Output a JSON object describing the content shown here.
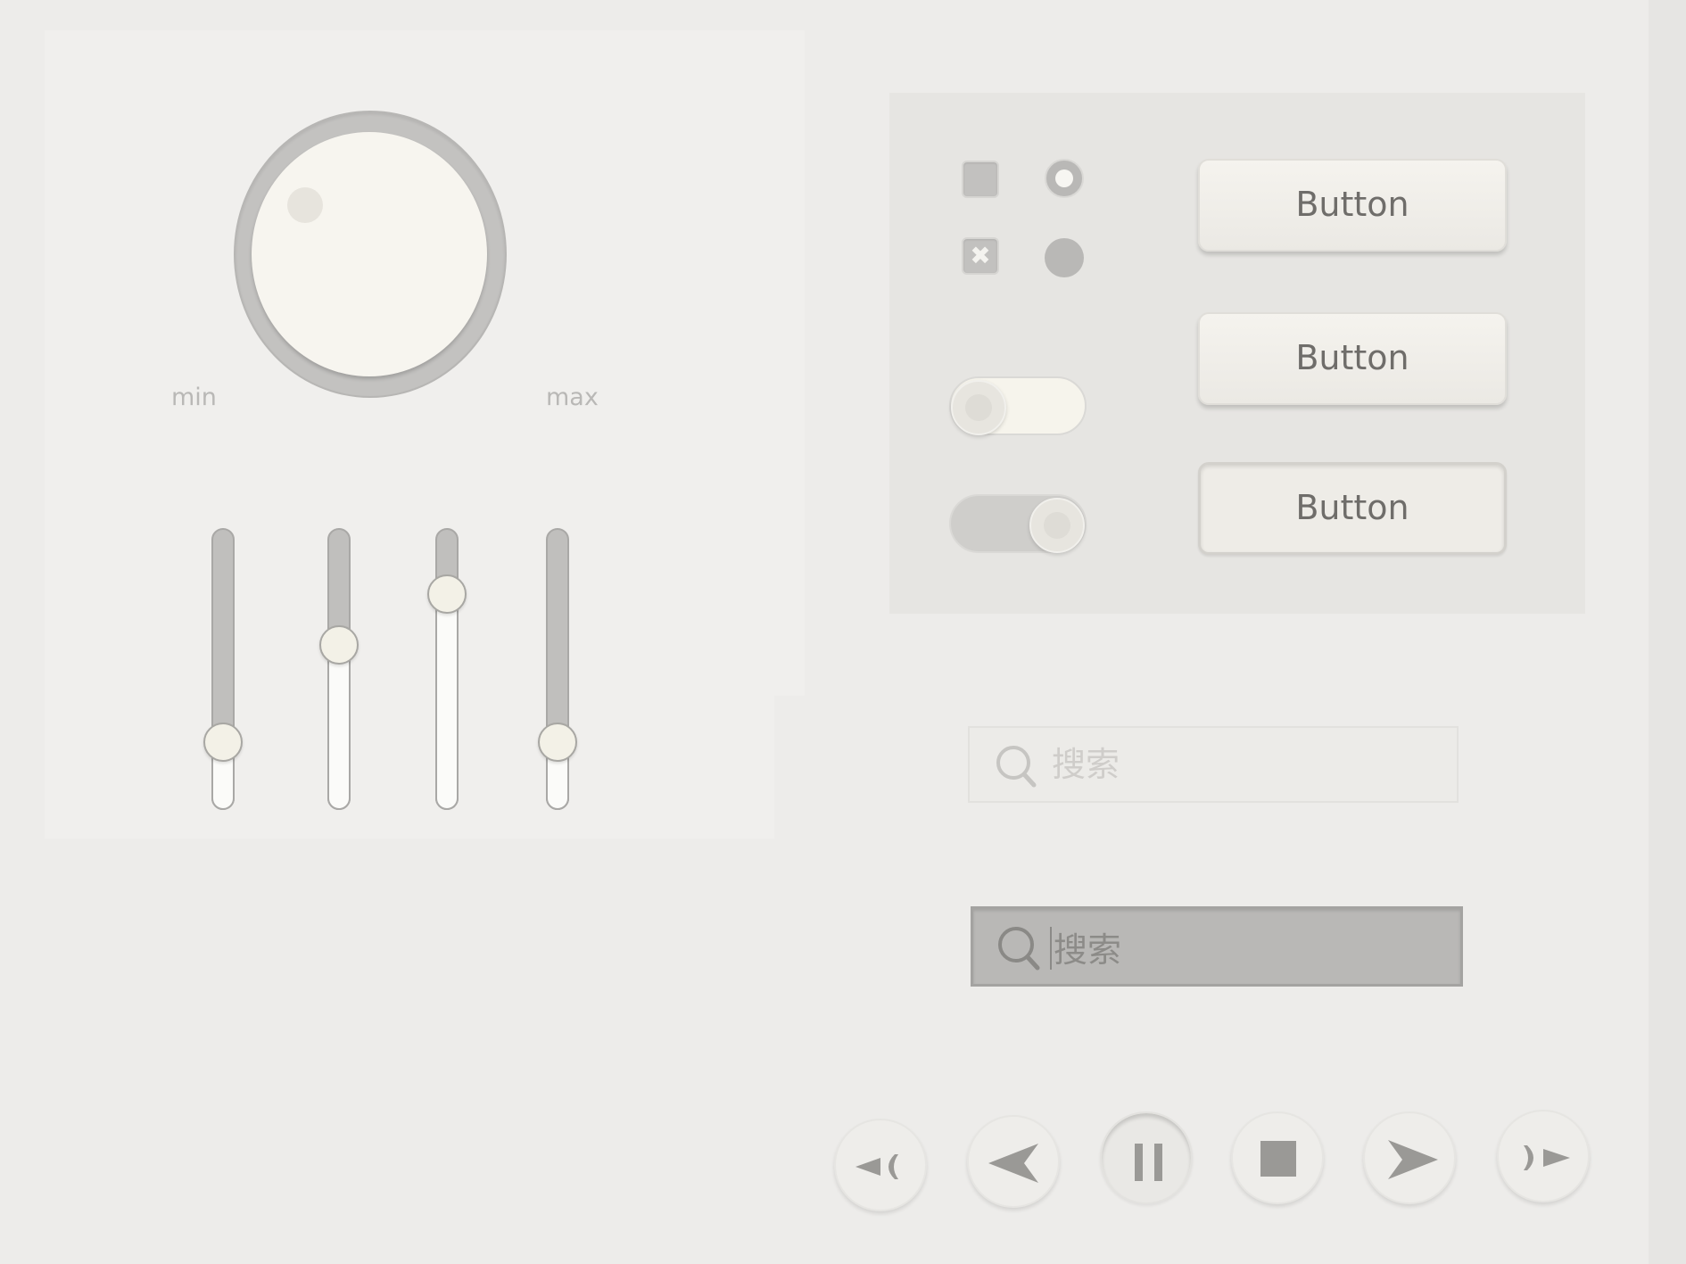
{
  "knob": {
    "min_label": "min",
    "max_label": "max"
  },
  "sliders": [
    {
      "name": "slider-1",
      "value": 0.2
    },
    {
      "name": "slider-2",
      "value": 0.6
    },
    {
      "name": "slider-3",
      "value": 0.81
    },
    {
      "name": "slider-4",
      "value": 0.2
    }
  ],
  "controls": {
    "checkbox_unchecked": {
      "checked": false
    },
    "checkbox_checked": {
      "checked": true,
      "mark": "✖"
    },
    "radio_selected": {
      "selected": true
    },
    "radio_unselected": {
      "selected": false
    },
    "toggle_off": {
      "on": false
    },
    "toggle_on": {
      "on": true
    }
  },
  "buttons": {
    "button_1": "Button",
    "button_2": "Button",
    "button_3": "Button"
  },
  "search": {
    "placeholder": "搜索",
    "active_value": "搜索"
  },
  "media": {
    "icons": [
      "rewind-icon",
      "previous-icon",
      "pause-icon",
      "stop-icon",
      "play-icon",
      "fast-forward-icon"
    ]
  },
  "colors": {
    "background": "#edecea",
    "panel": "#e6e5e2",
    "knob_face": "#f7f5ef",
    "control_gray": "#b9b8b6",
    "text": "#6f6d6a"
  }
}
